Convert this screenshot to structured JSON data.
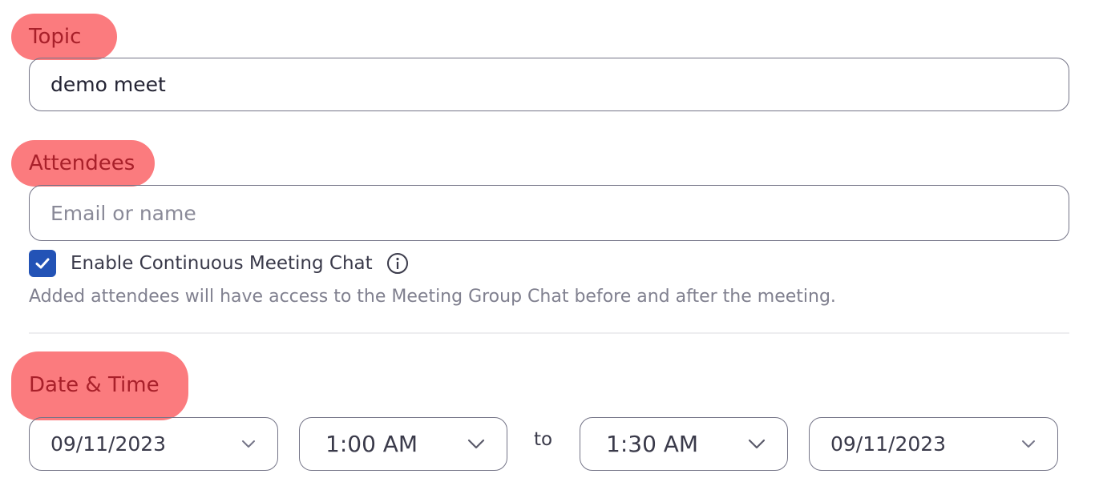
{
  "topic": {
    "label": "Topic",
    "value": "demo meet"
  },
  "attendees": {
    "label": "Attendees",
    "placeholder": "Email or name",
    "value": "",
    "continuous_chat": {
      "checked": true,
      "label": "Enable Continuous Meeting Chat",
      "info_icon": "info-circle-icon",
      "helper_text": "Added attendees will have access to the Meeting Group Chat before and after the meeting."
    }
  },
  "date_time": {
    "label": "Date & Time",
    "start_date": "09/11/2023",
    "start_time": "1:00 AM",
    "separator": "to",
    "end_time": "1:30 AM",
    "end_date": "09/11/2023"
  },
  "colors": {
    "highlight": "#fb7b7e",
    "highlight_text": "#a8202a",
    "checkbox": "#2353b6",
    "border": "#747487"
  }
}
